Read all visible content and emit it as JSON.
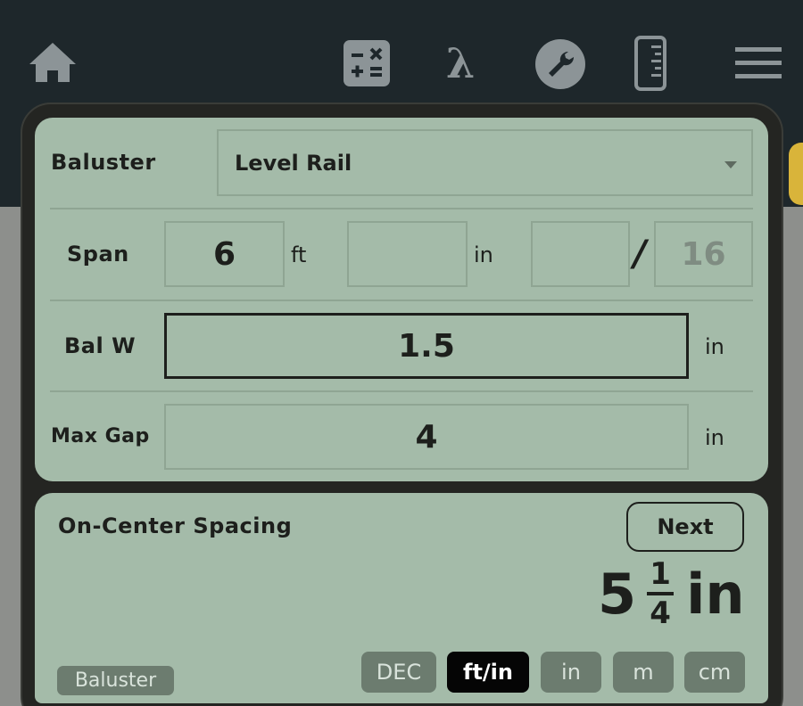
{
  "toolbar": {
    "icons": [
      "home-icon",
      "calculator-icon",
      "lambda-icon",
      "wrench-icon",
      "ruler-icon",
      "menu-icon"
    ],
    "lambda_glyph": "λ",
    "colors": {
      "bar": "#1e272b",
      "icon": "#8c9497",
      "accent_tab": "#d9b43a"
    }
  },
  "form": {
    "type_label": "Baluster",
    "type_value": "Level Rail",
    "span": {
      "label": "Span",
      "ft_value": "6",
      "ft_unit": "ft",
      "in_value": "",
      "in_unit": "in",
      "num_value": "",
      "slash": "/",
      "den_value": "16"
    },
    "bal_w": {
      "label": "Bal W",
      "value": "1.5",
      "unit": "in"
    },
    "max_gap": {
      "label": "Max Gap",
      "value": "4",
      "unit": "in"
    }
  },
  "result": {
    "title": "On-Center Spacing",
    "next_label": "Next",
    "whole": "5",
    "numerator": "1",
    "denominator": "4",
    "unit": "in",
    "badge": "Baluster",
    "modes": [
      "DEC",
      "ft/in",
      "in",
      "m",
      "cm"
    ],
    "selected_mode": "ft/in"
  },
  "colors": {
    "panel": "#a4bba9",
    "text": "#1d1f1c",
    "chip": "#6c7c6f",
    "chip_selected": "#050505"
  }
}
